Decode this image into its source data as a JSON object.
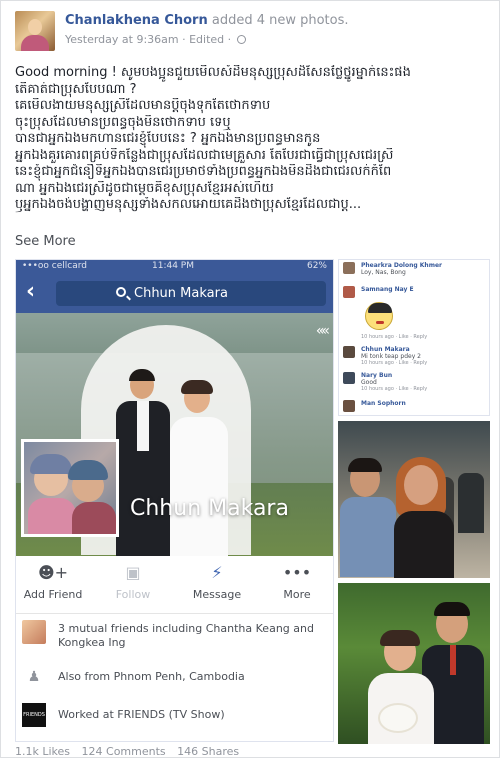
{
  "post": {
    "author": "Chanlakhena Chorn",
    "action": "added 4 new photos.",
    "timestamp": "Yesterday at 9:36am",
    "edited": "· Edited ·",
    "text_lines": [
      "Good morning ! សូមបងប្អូនជួយមើលសំដីមនុស្សប្រុសដ៏សែនថ្លៃថ្នូរម្នាក់នេះផង",
      "តើគាត់ជាប្រុសបែបណា ?",
      "គេមើលងាយមនុស្សស្រីដែលមានប្ដីចុងទុកតែថោកទាប",
      "ចុះប្រុសដែលមានប្រពន្ធចុងមិនថោកទាប ទេឬ",
      "បានជាអ្នកឯងមកហានជេរខ្ញុំបែបនេះ ? អ្នកឯងមានប្រពន្ធមានកូន",
      "អ្នកឯងគួរគោរពគ្រប់ទីកន្លែងជាប្រុសដែលជាមេគ្រួសារ តែបែរជាធ្វើជាប្រុសជេរស្រី",
      "នេះខ្ញុំជាអ្នកជំនឿទីអ្នកឯងបានជេរប្រមាថទាំងប្រពន្ធអ្នកឯងមិនដឹងជាជេរលក់កំពែ",
      "ណា អ្នកឯងជេរស្រីដូចជាម្ដេចគឺខុសប្រុសខ្មែរអស់ហើយ",
      "ឫអ្នកឯងចង់បង្ហាញមនុស្សទាំងសកលអោយគេដឹងថាប្រុសខ្មែរដែលជាប្ដ..."
    ],
    "see_more": "See More",
    "stats": {
      "likes": "1.1k Likes",
      "comments": "124 Comments",
      "shares": "146 Shares"
    }
  },
  "screenshot": {
    "status_carrier": "•••oo cellcard",
    "status_time": "11:44 PM",
    "status_battery": "62%",
    "search_text": "Chhun Makara",
    "profile_name": "Chhun Makara",
    "actions": [
      {
        "label": "Add Friend",
        "icon": "add-friend-icon"
      },
      {
        "label": "Follow",
        "icon": "follow-icon"
      },
      {
        "label": "Message",
        "icon": "messenger-icon"
      },
      {
        "label": "More",
        "icon": "more-icon"
      }
    ],
    "mutual_friends": "3 mutual friends including Chantha Keang and Kongkea Ing",
    "location": "Also from Phnom Penh, Cambodia",
    "work": "Worked at FRIENDS (TV Show)",
    "work_logo_text": "FRIENDS"
  },
  "comments_thumb": {
    "comments": [
      {
        "name": "Phearkra Dolong Khmer",
        "text": "Loy, Nas, Bong",
        "time": ""
      },
      {
        "name": "Samnang Nay E",
        "text": "",
        "time": "10 hours ago · Like · Reply"
      },
      {
        "name": "Chhun Makara",
        "text": "Mi tonk teap pdey 2",
        "time": "10 hours ago · Like · Reply"
      },
      {
        "name": "Nary Bun",
        "text": "Good",
        "time": "10 hours ago · Like · Reply"
      },
      {
        "name": "Man Sophorn",
        "text": "",
        "time": ""
      }
    ]
  },
  "colors": {
    "link_blue": "#365899",
    "fb_blue": "#3b5998",
    "muted_gray": "#90949c"
  }
}
